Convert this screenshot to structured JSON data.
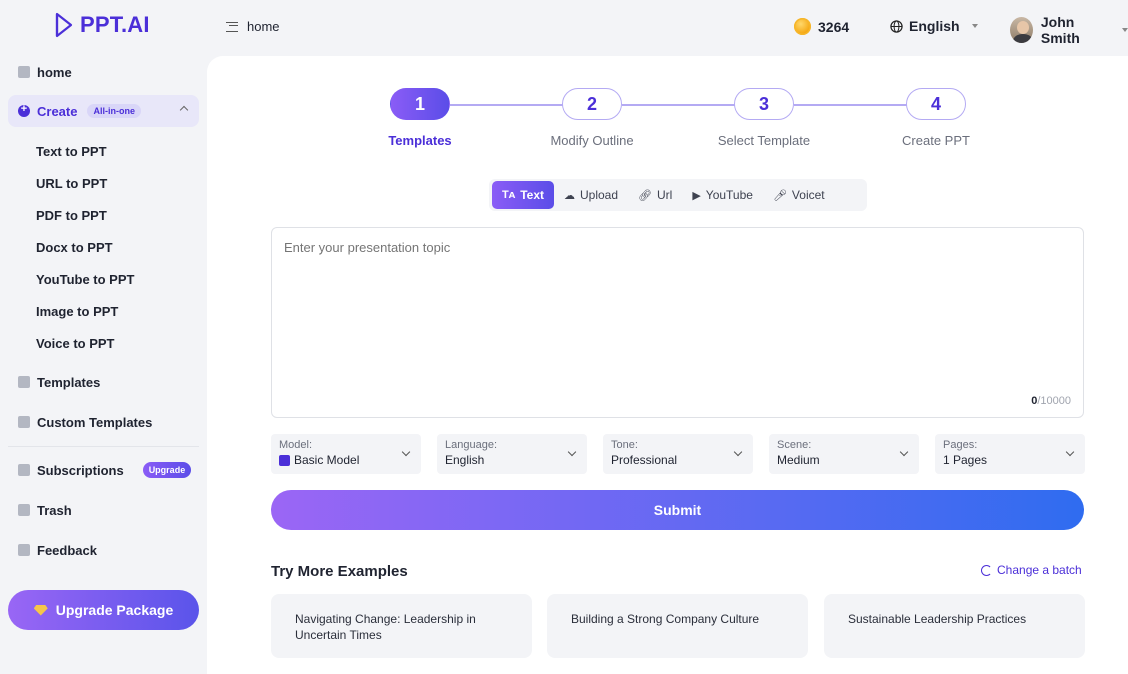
{
  "brand": {
    "name": "PPT.AI"
  },
  "header": {
    "breadcrumb": "home",
    "points": "3264",
    "language": "English",
    "user_name": "John Smith"
  },
  "sidebar": {
    "home": "home",
    "create": {
      "label": "Create",
      "badge": "All-in-one"
    },
    "create_items": [
      "Text to PPT",
      "URL to PPT",
      "PDF to PPT",
      "Docx to PPT",
      "YouTube to PPT",
      "Image to PPT",
      "Voice to PPT"
    ],
    "templates": "Templates",
    "custom_templates": "Custom Templates",
    "subscriptions": {
      "label": "Subscriptions",
      "badge": "Upgrade"
    },
    "trash": "Trash",
    "feedback": "Feedback",
    "upgrade_button": "Upgrade Package"
  },
  "stepper": {
    "steps": [
      {
        "number": "1",
        "label": "Templates",
        "active": true
      },
      {
        "number": "2",
        "label": "Modify Outline",
        "active": false
      },
      {
        "number": "3",
        "label": "Select Template",
        "active": false
      },
      {
        "number": "4",
        "label": "Create PPT",
        "active": false
      }
    ]
  },
  "input_tabs": [
    {
      "label": "Text",
      "icon": "text-icon",
      "active": true
    },
    {
      "label": "Upload",
      "icon": "cloud-upload-icon",
      "active": false
    },
    {
      "label": "Url",
      "icon": "link-icon",
      "active": false
    },
    {
      "label": "YouTube",
      "icon": "youtube-icon",
      "active": false
    },
    {
      "label": "Voicet",
      "icon": "microphone-icon",
      "active": false
    }
  ],
  "topic": {
    "placeholder": "Enter your presentation topic",
    "count": "0",
    "max": "/10000"
  },
  "options": {
    "model": {
      "label": "Model:",
      "value": "Basic Model"
    },
    "language": {
      "label": "Language:",
      "value": "English"
    },
    "tone": {
      "label": "Tone:",
      "value": "Professional"
    },
    "scene": {
      "label": "Scene:",
      "value": "Medium"
    },
    "pages": {
      "label": "Pages:",
      "value": "1 Pages"
    }
  },
  "submit_label": "Submit",
  "examples": {
    "title": "Try More Examples",
    "change_label": "Change a batch",
    "items": [
      "Navigating Change: Leadership in Uncertain Times",
      "Building a Strong Company Culture",
      "Sustainable Leadership Practices"
    ]
  },
  "colors": {
    "accent": "#4b2fd8",
    "gradient_start": "#8a5cf6",
    "gradient_end": "#2f6cf0"
  }
}
